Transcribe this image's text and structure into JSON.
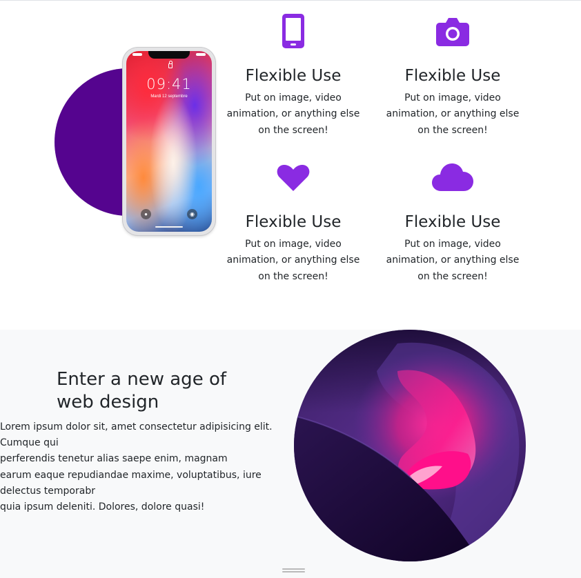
{
  "features": {
    "phone": {
      "time": "09:41",
      "date": "Mardi 12 septembre"
    },
    "items": [
      {
        "icon": "mobile-phone-icon",
        "title": "Flexible Use",
        "text": "Put on image, video animation, or anything else on the screen!"
      },
      {
        "icon": "camera-icon",
        "title": "Flexible Use",
        "text": "Put on image, video animation, or anything else on the screen!"
      },
      {
        "icon": "heart-icon",
        "title": "Flexible Use",
        "text": "Put on image, video animation, or anything else on the screen!"
      },
      {
        "icon": "cloud-icon",
        "title": "Flexible Use",
        "text": "Put on image, video animation, or anything else on the screen!"
      }
    ]
  },
  "hero": {
    "title": "Enter a new age of web design",
    "lines": [
      "Lorem ipsum dolor sit, amet consectetur adipisicing elit.",
      "Cumque qui",
      "perferendis tenetur alias saepe enim, magnam",
      "earum eaque repudiandae maxime, voluptatibus, iure",
      "delectus temporabr",
      "quia ipsum deleniti. Dolores, dolore quasi!"
    ]
  },
  "colors": {
    "accent": "#8a2be2",
    "blob": "#55048f",
    "text": "#212529",
    "hero_bg": "#f8f9fa"
  }
}
